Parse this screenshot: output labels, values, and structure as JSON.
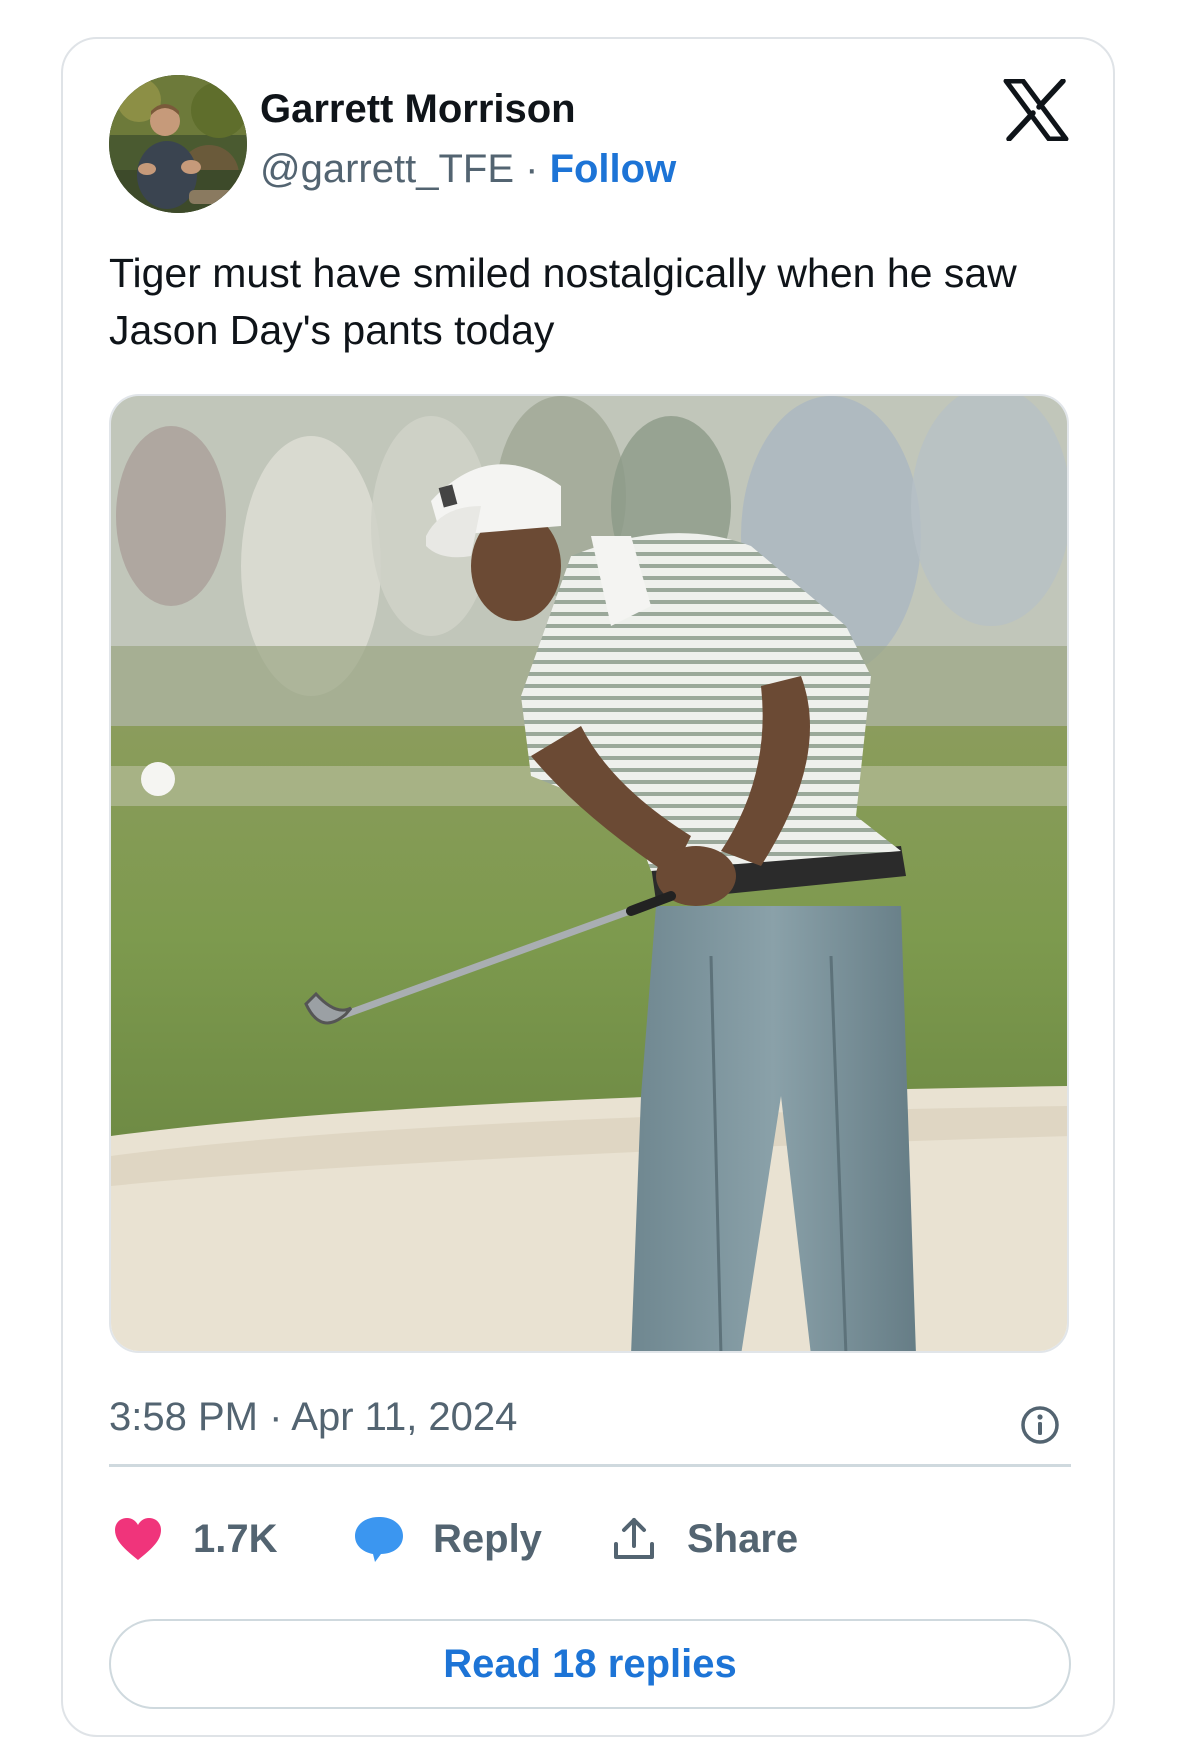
{
  "author": {
    "name": "Garrett Morrison",
    "handle": "@garrett_TFE",
    "separator": " · ",
    "follow_label": "Follow"
  },
  "tweet": {
    "text": "Tiger must have smiled nostalgically when he saw Jason Day's pants today",
    "timestamp": "3:58 PM · Apr 11, 2024"
  },
  "actions": {
    "like_count": "1.7K",
    "reply_label": "Reply",
    "share_label": "Share"
  },
  "read_replies_label": "Read 18 replies",
  "icons": {
    "brand": "x-logo-icon",
    "info": "info-icon",
    "like": "heart-icon",
    "reply": "speech-bubble-icon",
    "share": "share-upload-icon"
  },
  "colors": {
    "link_blue": "#1d74d6",
    "heart_pink": "#f0347b",
    "reply_blue": "#3b96f0",
    "secondary_text": "#536471",
    "border": "#cfd9de"
  }
}
